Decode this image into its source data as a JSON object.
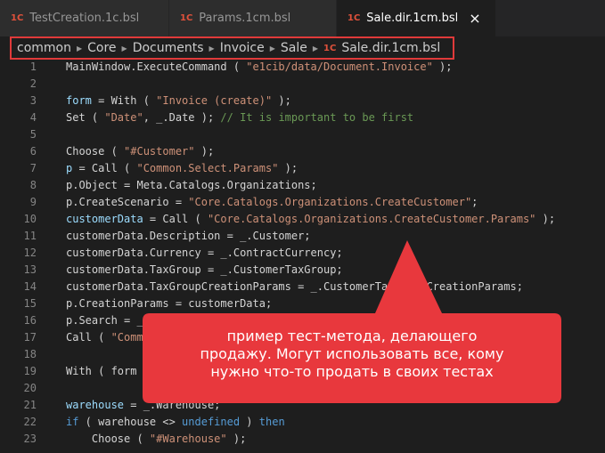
{
  "tabs": [
    {
      "icon_text": "1C",
      "label": "TestCreation.1c.bsl",
      "active": false
    },
    {
      "icon_text": "1C",
      "label": "Params.1cm.bsl",
      "active": false
    },
    {
      "icon_text": "1C",
      "label": "Sale.dir.1cm.bsl",
      "active": true,
      "close": "×"
    }
  ],
  "breadcrumb": {
    "segments": [
      "common",
      "Core",
      "Documents",
      "Invoice",
      "Sale"
    ],
    "file_icon_text": "1C",
    "file": "Sale.dir.1cm.bsl",
    "separator": "▶"
  },
  "code": {
    "lines": [
      {
        "n": "1",
        "t": [
          [
            "MainWindow.ExecuteCommand ( ",
            "p"
          ],
          [
            "\"e1cib/data/Document.Invoice\"",
            "str"
          ],
          [
            " );",
            "p"
          ]
        ]
      },
      {
        "n": "2",
        "t": []
      },
      {
        "n": "3",
        "t": [
          [
            "form",
            "var"
          ],
          [
            " = With ( ",
            "p"
          ],
          [
            "\"Invoice (create)\"",
            "str"
          ],
          [
            " );",
            "p"
          ]
        ]
      },
      {
        "n": "4",
        "t": [
          [
            "Set ( ",
            "p"
          ],
          [
            "\"Date\"",
            "str"
          ],
          [
            ", _.Date ); ",
            "p"
          ],
          [
            "// It is important to be first",
            "cmt"
          ]
        ]
      },
      {
        "n": "5",
        "t": []
      },
      {
        "n": "6",
        "t": [
          [
            "Choose ( ",
            "p"
          ],
          [
            "\"#Customer\"",
            "str"
          ],
          [
            " );",
            "p"
          ]
        ]
      },
      {
        "n": "7",
        "t": [
          [
            "p",
            "var"
          ],
          [
            " = Call ( ",
            "p"
          ],
          [
            "\"Common.Select.Params\"",
            "str"
          ],
          [
            " );",
            "p"
          ]
        ]
      },
      {
        "n": "8",
        "t": [
          [
            "p.Object = Meta.Catalogs.Organizations;",
            "p"
          ]
        ]
      },
      {
        "n": "9",
        "t": [
          [
            "p.CreateScenario = ",
            "p"
          ],
          [
            "\"Core.Catalogs.Organizations.CreateCustomer\"",
            "str"
          ],
          [
            ";",
            "p"
          ]
        ]
      },
      {
        "n": "10",
        "t": [
          [
            "customerData",
            "var"
          ],
          [
            " = Call ( ",
            "p"
          ],
          [
            "\"Core.Catalogs.Organizations.CreateCustomer.Params\"",
            "str"
          ],
          [
            " );",
            "p"
          ]
        ]
      },
      {
        "n": "11",
        "t": [
          [
            "customerData.Description = _.Customer;",
            "p"
          ]
        ]
      },
      {
        "n": "12",
        "t": [
          [
            "customerData.Currency = _.ContractCurrency;",
            "p"
          ]
        ]
      },
      {
        "n": "13",
        "t": [
          [
            "customerData.TaxGroup = _.CustomerTaxGroup;",
            "p"
          ]
        ]
      },
      {
        "n": "14",
        "t": [
          [
            "customerData.TaxGroupCreationParams = _.CustomerTaxGroupCreationParams;",
            "p"
          ]
        ]
      },
      {
        "n": "15",
        "t": [
          [
            "p.CreationParams = customerData;",
            "p"
          ]
        ]
      },
      {
        "n": "16",
        "t": [
          [
            "p.Search = _",
            "p"
          ]
        ]
      },
      {
        "n": "17",
        "t": [
          [
            "Call ( ",
            "p"
          ],
          [
            "\"Comm",
            "str"
          ]
        ]
      },
      {
        "n": "18",
        "t": []
      },
      {
        "n": "19",
        "t": [
          [
            "With ( form",
            "p"
          ]
        ]
      },
      {
        "n": "20",
        "t": []
      },
      {
        "n": "21",
        "t": [
          [
            "warehouse",
            "var"
          ],
          [
            " = _.Warehouse;",
            "p"
          ]
        ]
      },
      {
        "n": "22",
        "t": [
          [
            "if",
            "kw"
          ],
          [
            " ( warehouse <> ",
            "p"
          ],
          [
            "undefined",
            "kw"
          ],
          [
            " ) ",
            "p"
          ],
          [
            "then",
            "kw"
          ]
        ]
      },
      {
        "n": "23",
        "t": [
          [
            "    Choose ( ",
            "p"
          ],
          [
            "\"#Warehouse\"",
            "str"
          ],
          [
            " );",
            "p"
          ]
        ]
      }
    ]
  },
  "callout": {
    "color": "#e8383d",
    "lines": [
      "пример тест-метода, делающего",
      "продажу. Могут использовать все, кому",
      "нужно что-то продать в своих тестах"
    ]
  }
}
